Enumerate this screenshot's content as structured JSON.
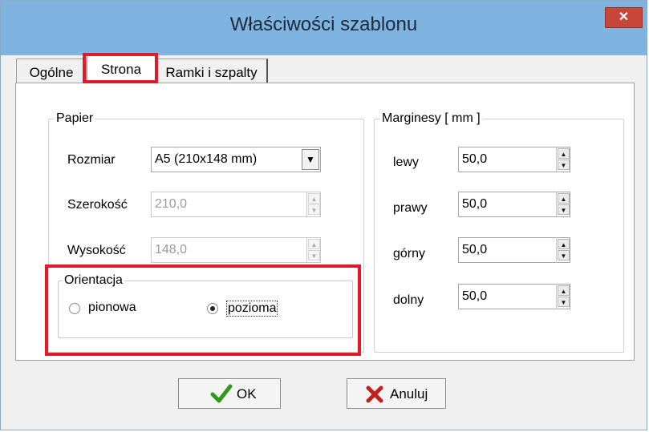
{
  "window": {
    "title": "Właściwości szablonu",
    "close_glyph": "✕"
  },
  "tabs": [
    {
      "label": "Ogólne",
      "selected": false
    },
    {
      "label": "Strona",
      "selected": true
    },
    {
      "label": "Ramki i szpalty",
      "selected": false
    }
  ],
  "paper": {
    "group_label": "Papier",
    "size_label": "Rozmiar",
    "size_value": "A5 (210x148 mm)",
    "width_label": "Szerokość",
    "width_value": "210,0",
    "height_label": "Wysokość",
    "height_value": "148,0"
  },
  "orientation": {
    "group_label": "Orientacja",
    "options": [
      {
        "label": "pionowa",
        "selected": false
      },
      {
        "label": "pozioma",
        "selected": true
      }
    ]
  },
  "margins": {
    "group_label": "Marginesy [ mm ]",
    "left_label": "lewy",
    "left_value": "50,0",
    "right_label": "prawy",
    "right_value": "50,0",
    "top_label": "górny",
    "top_value": "50,0",
    "bottom_label": "dolny",
    "bottom_value": "50,0"
  },
  "buttons": {
    "ok_label": "OK",
    "cancel_label": "Anuluj"
  },
  "colors": {
    "titlebar": "#7fb3e0",
    "close": "#c7463a",
    "highlight": "#e0192b",
    "ok_check": "#2e9a1a",
    "cancel_x": "#c21f1f"
  }
}
